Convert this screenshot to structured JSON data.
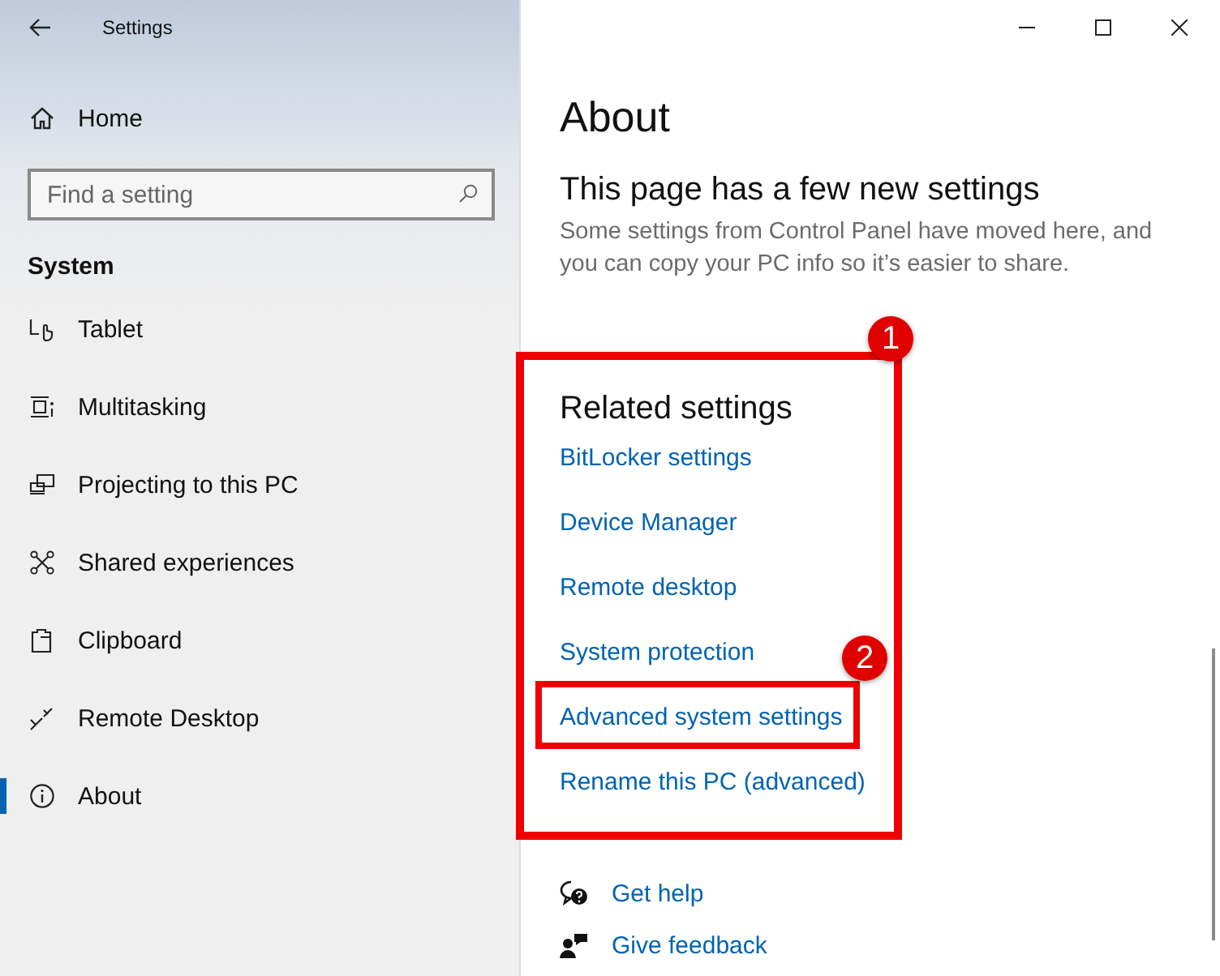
{
  "window": {
    "title": "Settings"
  },
  "sidebar": {
    "home": "Home",
    "search": {
      "placeholder": "Find a setting"
    },
    "section": "System",
    "items": [
      {
        "label": "Tablet",
        "kind": "tablet",
        "selected": false
      },
      {
        "label": "Multitasking",
        "kind": "multitasking",
        "selected": false
      },
      {
        "label": "Projecting to this PC",
        "kind": "projecting",
        "selected": false
      },
      {
        "label": "Shared experiences",
        "kind": "shared",
        "selected": false
      },
      {
        "label": "Clipboard",
        "kind": "clipboard",
        "selected": false
      },
      {
        "label": "Remote Desktop",
        "kind": "remote",
        "selected": false
      },
      {
        "label": "About",
        "kind": "about",
        "selected": true
      }
    ]
  },
  "content": {
    "title": "About",
    "notice_heading": "This page has a few new settings",
    "notice_text": "Some settings from Control Panel have moved here, and you can copy your PC info so it’s easier to share.",
    "related_title": "Related settings",
    "related_links": [
      "BitLocker settings",
      "Device Manager",
      "Remote desktop",
      "System protection",
      "Advanced system settings",
      "Rename this PC (advanced)"
    ],
    "support_links": [
      {
        "label": "Get help",
        "kind": "help"
      },
      {
        "label": "Give feedback",
        "kind": "feedback"
      }
    ]
  },
  "annotations": [
    {
      "label": "1"
    },
    {
      "label": "2"
    }
  ]
}
